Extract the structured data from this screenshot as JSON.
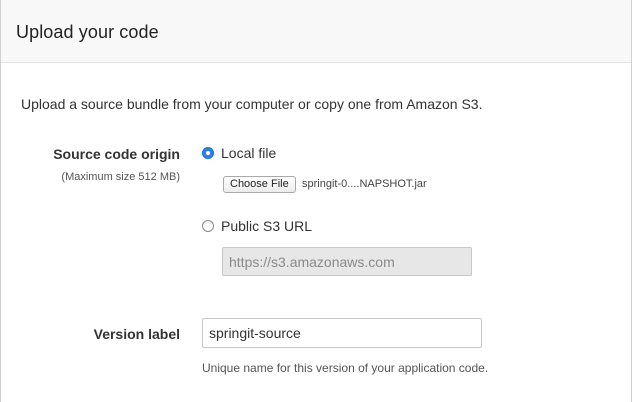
{
  "header": {
    "title": "Upload your code"
  },
  "intro": "Upload a source bundle from your computer or copy one from Amazon S3.",
  "source_origin": {
    "label": "Source code origin",
    "sublabel": "(Maximum size 512 MB)",
    "options": [
      {
        "label": "Local file",
        "selected": true
      },
      {
        "label": "Public S3 URL",
        "selected": false
      }
    ],
    "choose_file_label": "Choose File",
    "file_name": "springit-0....NAPSHOT.jar",
    "s3_url_placeholder": "https://s3.amazonaws.com"
  },
  "version": {
    "label": "Version label",
    "value": "springit-source",
    "help": "Unique name for this version of your application code."
  },
  "colors": {
    "accent": "#2f80ed",
    "header_bg": "#f8f8f8",
    "disabled_input_bg": "#e7e7e7"
  }
}
